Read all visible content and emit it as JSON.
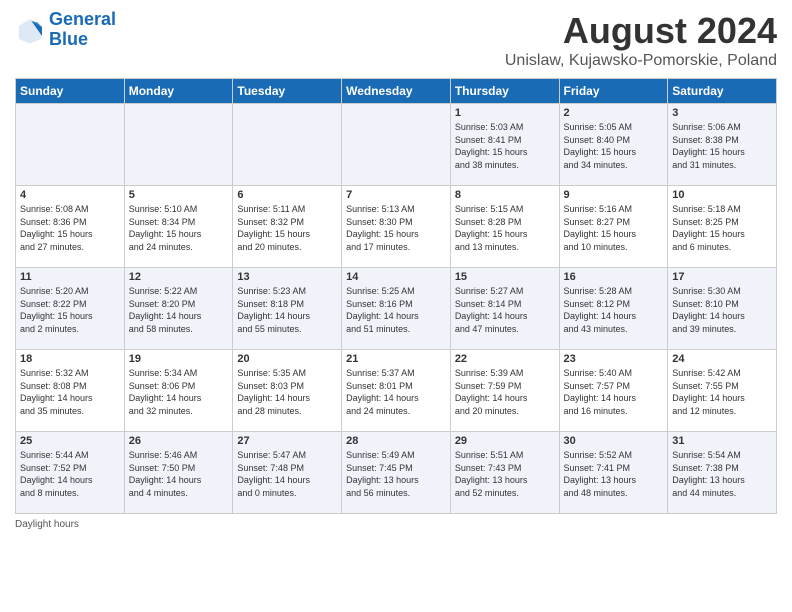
{
  "logo": {
    "line1": "General",
    "line2": "Blue"
  },
  "title": "August 2024",
  "subtitle": "Unislaw, Kujawsko-Pomorskie, Poland",
  "columns": [
    "Sunday",
    "Monday",
    "Tuesday",
    "Wednesday",
    "Thursday",
    "Friday",
    "Saturday"
  ],
  "weeks": [
    [
      {
        "day": "",
        "info": ""
      },
      {
        "day": "",
        "info": ""
      },
      {
        "day": "",
        "info": ""
      },
      {
        "day": "",
        "info": ""
      },
      {
        "day": "1",
        "info": "Sunrise: 5:03 AM\nSunset: 8:41 PM\nDaylight: 15 hours\nand 38 minutes."
      },
      {
        "day": "2",
        "info": "Sunrise: 5:05 AM\nSunset: 8:40 PM\nDaylight: 15 hours\nand 34 minutes."
      },
      {
        "day": "3",
        "info": "Sunrise: 5:06 AM\nSunset: 8:38 PM\nDaylight: 15 hours\nand 31 minutes."
      }
    ],
    [
      {
        "day": "4",
        "info": "Sunrise: 5:08 AM\nSunset: 8:36 PM\nDaylight: 15 hours\nand 27 minutes."
      },
      {
        "day": "5",
        "info": "Sunrise: 5:10 AM\nSunset: 8:34 PM\nDaylight: 15 hours\nand 24 minutes."
      },
      {
        "day": "6",
        "info": "Sunrise: 5:11 AM\nSunset: 8:32 PM\nDaylight: 15 hours\nand 20 minutes."
      },
      {
        "day": "7",
        "info": "Sunrise: 5:13 AM\nSunset: 8:30 PM\nDaylight: 15 hours\nand 17 minutes."
      },
      {
        "day": "8",
        "info": "Sunrise: 5:15 AM\nSunset: 8:28 PM\nDaylight: 15 hours\nand 13 minutes."
      },
      {
        "day": "9",
        "info": "Sunrise: 5:16 AM\nSunset: 8:27 PM\nDaylight: 15 hours\nand 10 minutes."
      },
      {
        "day": "10",
        "info": "Sunrise: 5:18 AM\nSunset: 8:25 PM\nDaylight: 15 hours\nand 6 minutes."
      }
    ],
    [
      {
        "day": "11",
        "info": "Sunrise: 5:20 AM\nSunset: 8:22 PM\nDaylight: 15 hours\nand 2 minutes."
      },
      {
        "day": "12",
        "info": "Sunrise: 5:22 AM\nSunset: 8:20 PM\nDaylight: 14 hours\nand 58 minutes."
      },
      {
        "day": "13",
        "info": "Sunrise: 5:23 AM\nSunset: 8:18 PM\nDaylight: 14 hours\nand 55 minutes."
      },
      {
        "day": "14",
        "info": "Sunrise: 5:25 AM\nSunset: 8:16 PM\nDaylight: 14 hours\nand 51 minutes."
      },
      {
        "day": "15",
        "info": "Sunrise: 5:27 AM\nSunset: 8:14 PM\nDaylight: 14 hours\nand 47 minutes."
      },
      {
        "day": "16",
        "info": "Sunrise: 5:28 AM\nSunset: 8:12 PM\nDaylight: 14 hours\nand 43 minutes."
      },
      {
        "day": "17",
        "info": "Sunrise: 5:30 AM\nSunset: 8:10 PM\nDaylight: 14 hours\nand 39 minutes."
      }
    ],
    [
      {
        "day": "18",
        "info": "Sunrise: 5:32 AM\nSunset: 8:08 PM\nDaylight: 14 hours\nand 35 minutes."
      },
      {
        "day": "19",
        "info": "Sunrise: 5:34 AM\nSunset: 8:06 PM\nDaylight: 14 hours\nand 32 minutes."
      },
      {
        "day": "20",
        "info": "Sunrise: 5:35 AM\nSunset: 8:03 PM\nDaylight: 14 hours\nand 28 minutes."
      },
      {
        "day": "21",
        "info": "Sunrise: 5:37 AM\nSunset: 8:01 PM\nDaylight: 14 hours\nand 24 minutes."
      },
      {
        "day": "22",
        "info": "Sunrise: 5:39 AM\nSunset: 7:59 PM\nDaylight: 14 hours\nand 20 minutes."
      },
      {
        "day": "23",
        "info": "Sunrise: 5:40 AM\nSunset: 7:57 PM\nDaylight: 14 hours\nand 16 minutes."
      },
      {
        "day": "24",
        "info": "Sunrise: 5:42 AM\nSunset: 7:55 PM\nDaylight: 14 hours\nand 12 minutes."
      }
    ],
    [
      {
        "day": "25",
        "info": "Sunrise: 5:44 AM\nSunset: 7:52 PM\nDaylight: 14 hours\nand 8 minutes."
      },
      {
        "day": "26",
        "info": "Sunrise: 5:46 AM\nSunset: 7:50 PM\nDaylight: 14 hours\nand 4 minutes."
      },
      {
        "day": "27",
        "info": "Sunrise: 5:47 AM\nSunset: 7:48 PM\nDaylight: 14 hours\nand 0 minutes."
      },
      {
        "day": "28",
        "info": "Sunrise: 5:49 AM\nSunset: 7:45 PM\nDaylight: 13 hours\nand 56 minutes."
      },
      {
        "day": "29",
        "info": "Sunrise: 5:51 AM\nSunset: 7:43 PM\nDaylight: 13 hours\nand 52 minutes."
      },
      {
        "day": "30",
        "info": "Sunrise: 5:52 AM\nSunset: 7:41 PM\nDaylight: 13 hours\nand 48 minutes."
      },
      {
        "day": "31",
        "info": "Sunrise: 5:54 AM\nSunset: 7:38 PM\nDaylight: 13 hours\nand 44 minutes."
      }
    ]
  ],
  "footer": "Daylight hours"
}
